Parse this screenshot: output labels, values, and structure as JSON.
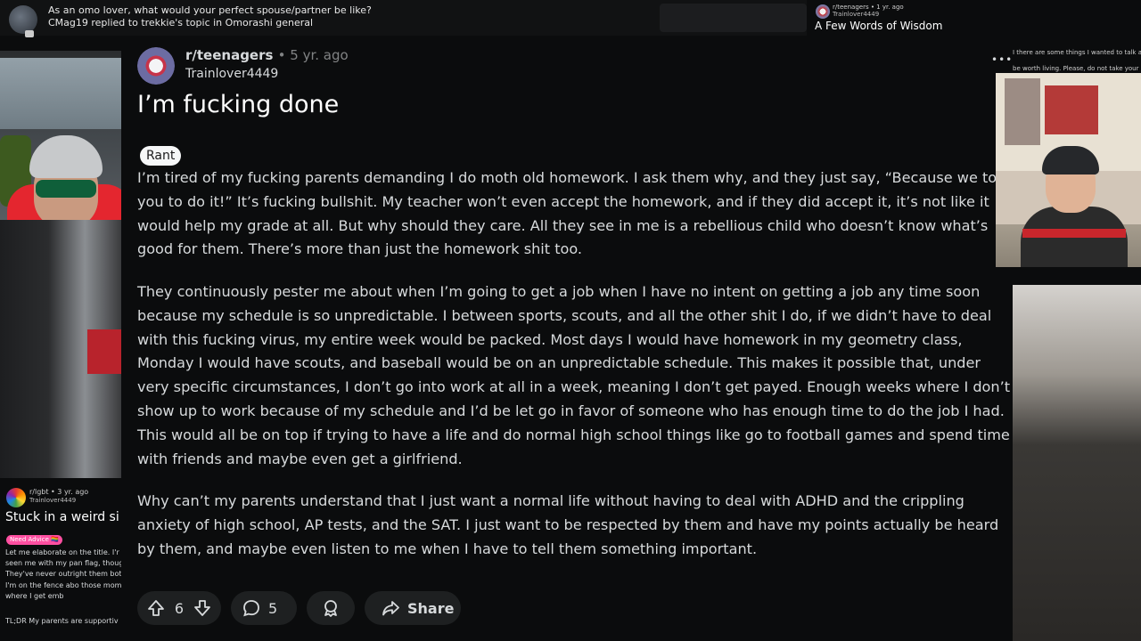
{
  "notification": {
    "line1": "As an omo lover, what would your perfect spouse/partner be like?",
    "line2": "CMag19 replied to trekkie's topic in Omorashi general"
  },
  "mini_post": {
    "subreddit": "r/teenagers • 1 yr. ago",
    "user": "Trainlover4449",
    "title": "A Few Words of Wisdom"
  },
  "left_card": {
    "subreddit": "r/lgbt • 3 yr. ago",
    "user": "Trainlover4449",
    "title": "Stuck in a weird si",
    "flair": "Need Advice 🏳️‍🌈",
    "body": "Let me elaborate on the title. I'r have seen me with my pan flag, though. They've never outright them both. I'm on the fence abo those moments where I get emb",
    "tldr": "TL;DR My parents are supportiv"
  },
  "right_side": {
    "text1": "I there are some things I wanted to talk about.",
    "text2": "be worth living. Please, do not take your life",
    "menu_dots": "•••"
  },
  "post": {
    "subreddit": "r/teenagers",
    "age": "• 5 yr. ago",
    "author": "Trainlover4449",
    "title": "I’m fucking done",
    "flair": "Rant",
    "paragraphs": [
      "I’m tired of my fucking parents demanding I do moth old homework. I ask them why, and they just say, “Because we told you to do it!” It’s fucking bullshit. My teacher won’t even accept the homework, and if they did accept it, it’s not like it would help my grade at all. But why should they care. All they see in me is a rebellious child who doesn’t know what’s good for them. There’s more than just the homework shit too.",
      "They continuously pester me about when I’m going to get a job when I have no intent on getting a job any time soon because my schedule is so unpredictable. I between sports, scouts, and all the other shit I do, if we didn’t have to deal with this fucking virus, my entire week would be packed. Most days I would have homework in my geometry class, Monday I would have scouts, and baseball would be on an unpredictable schedule. This makes it possible that, under very specific circumstances, I don’t go into work at all in a week, meaning I don’t get payed. Enough weeks where I don’t show up to work because of my schedule and I’d be let go in favor of someone who has enough time to do the job I had. This would all be on top if trying to have a life and do normal high school things like go to football games and spend time with friends and maybe even get a girlfriend.",
      "Why can’t my parents understand that I just want a normal life without having to deal with ADHD and the crippling anxiety of high school, AP tests, and the SAT. I just want to be respected by them and have my points actually be heard by them, and maybe even listen to me when I have to tell them something important."
    ],
    "votes": "6",
    "comments": "5",
    "share_label": "Share"
  },
  "icons": [
    "upvote-icon",
    "downvote-icon",
    "comment-icon",
    "award-icon",
    "share-icon"
  ],
  "colors": {
    "background": "#0b0c0d",
    "pill": "#1e2021",
    "text": "#d7dadc",
    "flair_bg": "#f6f7f8",
    "flair_pink": "#ff4fa1"
  }
}
